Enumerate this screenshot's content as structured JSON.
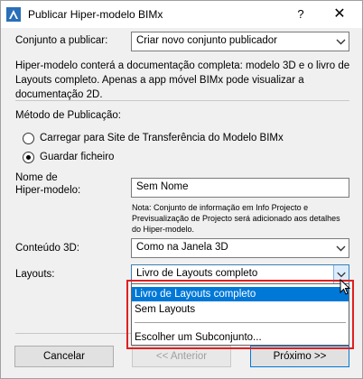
{
  "window": {
    "title": "Publicar Hiper-modelo BIMx",
    "help_glyph": "?",
    "close_glyph": "✕"
  },
  "set": {
    "label": "Conjunto a publicar:",
    "value": "Criar novo conjunto publicador"
  },
  "description": "Hiper-modelo conterá a documentação completa: modelo 3D e o livro de Layouts completo. Apenas a app móvel BIMx pode visualizar a documentação 2D.",
  "method": {
    "label": "Método de Publicação:",
    "options": [
      {
        "label": "Carregar para Site de Transferência do Modelo BIMx",
        "checked": false
      },
      {
        "label": "Guardar ficheiro",
        "checked": true
      }
    ]
  },
  "name": {
    "label_line1": "Nome de",
    "label_line2": "Hiper-modelo:",
    "value": "Sem Nome",
    "note": "Nota: Conjunto de informação em Info Projecto e Previsualização de Projecto será adicionado aos detalhes do Hiper-modelo."
  },
  "content3d": {
    "label": "Conteúdo 3D:",
    "value": "Como na Janela 3D"
  },
  "layouts": {
    "label": "Layouts:",
    "value": "Livro de Layouts completo",
    "options": [
      {
        "label": "Livro de Layouts completo",
        "selected": true
      },
      {
        "label": "Sem Layouts",
        "selected": false
      },
      {
        "label": "Escolher um Subconjunto...",
        "selected": false
      }
    ]
  },
  "buttons": {
    "cancel": "Cancelar",
    "previous": "<< Anterior",
    "next": "Próximo >>"
  },
  "colors": {
    "selection": "#0078d7",
    "highlight_outline": "#e02020"
  }
}
